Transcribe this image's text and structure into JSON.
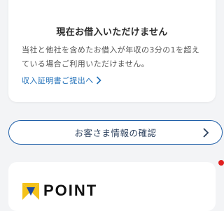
{
  "notice_card": {
    "title": "現在お借入いただけません",
    "body": "当社と他社を含めたお借入が年収の3分の1を超えている場合ご利用いただけません。",
    "link_label": "収入証明書ご提出へ",
    "link_icon": "chevron-right-icon"
  },
  "customer_info": {
    "button_label": "お客さま情報の確認",
    "icon": "chevron-right-icon"
  },
  "tpoint_card": {
    "logo_icon": "tpoint-logo-icon",
    "logo_text": "POINT"
  },
  "colors": {
    "link": "#1f6fb8",
    "pill_border": "#1f5fa8",
    "tpoint_yellow": "#f4c21b",
    "tpoint_blue": "#1e4aa0",
    "badge_red": "#e02020"
  }
}
